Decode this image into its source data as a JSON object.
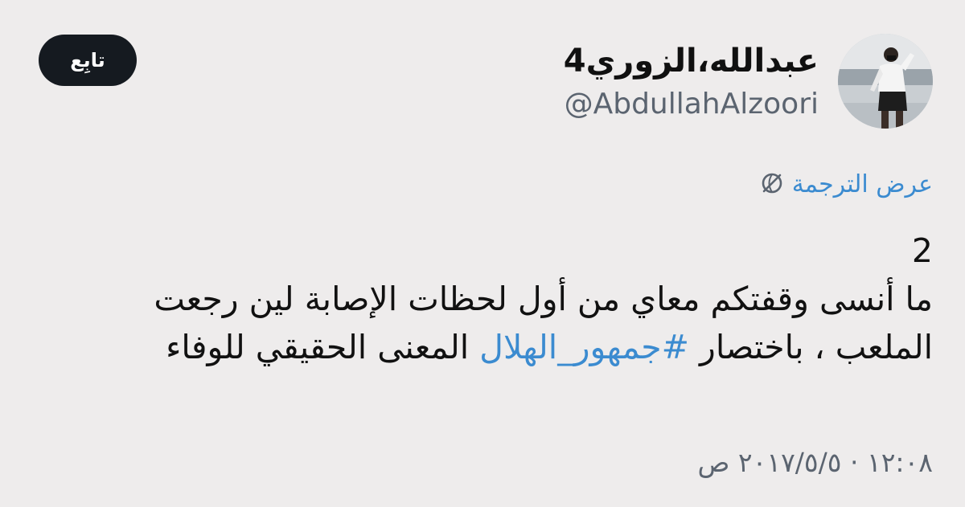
{
  "tweet": {
    "display_name": "عبدالله،الزوري4",
    "handle": "@AbdullahAlzoori",
    "follow_label": "تابِع",
    "translate_label": "عرض الترجمة",
    "body_number": "2",
    "body_line_1": "ما أنسى وقفتكم معاي من أول لحظات الإصابة لين رجعت",
    "body_line_2_start": "الملعب ، باختصار",
    "hashtag": "#جمهور_الهلال",
    "body_line_2_end": "المعنى الحقيقي للوفاء",
    "timestamp": "١٢:٠٨ · ٢٠١٧/٥/٥ ص"
  },
  "icons": {
    "translate": "globe-slash-icon",
    "avatar": "profile-photo"
  },
  "colors": {
    "background": "#eeecec",
    "link": "#3b8bd0",
    "secondary_text": "#5b6470",
    "button_bg": "#151a20"
  }
}
